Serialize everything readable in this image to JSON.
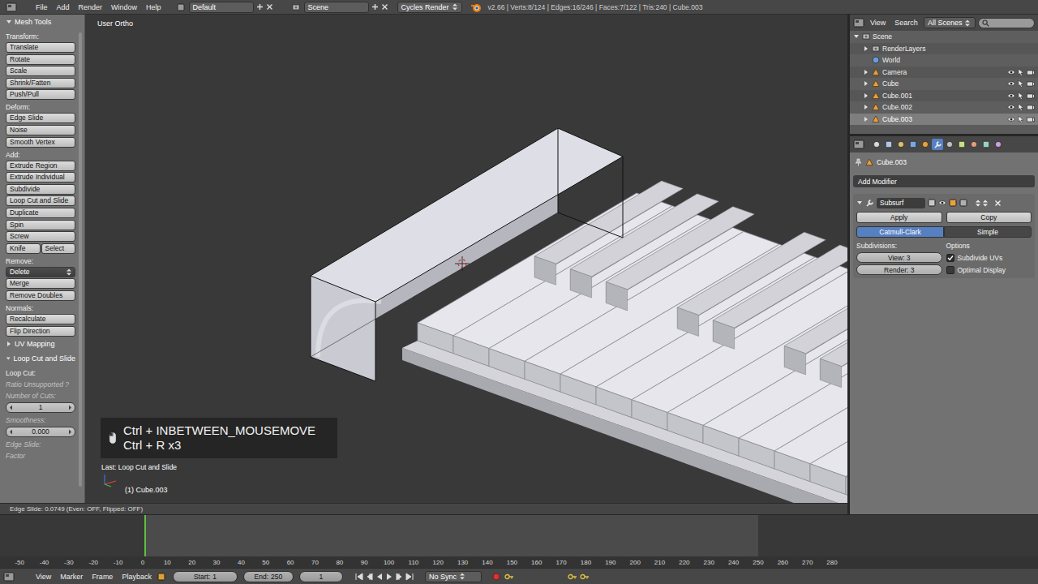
{
  "header": {
    "menus": [
      "File",
      "Add",
      "Render",
      "Window",
      "Help"
    ],
    "layout": "Default",
    "scene": "Scene",
    "engine": "Cycles Render",
    "stats": "v2.66 | Verts:8/124 | Edges:16/246 | Faces:7/122 | Tris:240 | Cube.003"
  },
  "toolShelf": {
    "title": "Mesh Tools",
    "expanded": true,
    "groups": [
      {
        "label": "Transform:",
        "rows": [
          {
            "kind": "button",
            "labels": [
              "Translate"
            ]
          },
          {
            "kind": "button",
            "labels": [
              "Rotate"
            ]
          },
          {
            "kind": "button",
            "labels": [
              "Scale"
            ]
          },
          {
            "kind": "button",
            "labels": [
              "Shrink/Fatten"
            ]
          },
          {
            "kind": "button",
            "labels": [
              "Push/Pull"
            ]
          }
        ]
      },
      {
        "label": "Deform:",
        "rows": [
          {
            "kind": "button",
            "labels": [
              "Edge Slide"
            ]
          },
          {
            "kind": "button",
            "labels": [
              "Noise"
            ]
          },
          {
            "kind": "button",
            "labels": [
              "Smooth Vertex"
            ]
          }
        ]
      },
      {
        "label": "Add:",
        "rows": [
          {
            "kind": "button",
            "labels": [
              "Extrude Region"
            ]
          },
          {
            "kind": "button",
            "labels": [
              "Extrude Individual"
            ]
          },
          {
            "kind": "button",
            "labels": [
              "Subdivide"
            ]
          },
          {
            "kind": "button",
            "labels": [
              "Loop Cut and Slide"
            ]
          },
          {
            "kind": "button",
            "labels": [
              "Duplicate"
            ]
          },
          {
            "kind": "button",
            "labels": [
              "Spin"
            ]
          },
          {
            "kind": "button",
            "labels": [
              "Screw"
            ]
          },
          {
            "kind": "pair",
            "labels": [
              "Knife",
              "Select"
            ]
          }
        ]
      },
      {
        "label": "Remove:",
        "rows": [
          {
            "kind": "menu",
            "labels": [
              "Delete"
            ]
          },
          {
            "kind": "button",
            "labels": [
              "Merge"
            ]
          },
          {
            "kind": "button",
            "labels": [
              "Remove Doubles"
            ]
          }
        ]
      },
      {
        "label": "Normals:",
        "rows": [
          {
            "kind": "button",
            "labels": [
              "Recalculate"
            ]
          },
          {
            "kind": "button",
            "labels": [
              "Flip Direction"
            ]
          }
        ]
      }
    ],
    "collapsed": [
      {
        "label": "UV Mapping",
        "expanded": false
      }
    ],
    "operator": {
      "title": "Loop Cut and Slide",
      "expanded": true,
      "items": [
        {
          "kind": "label",
          "text": "Loop Cut:"
        },
        {
          "kind": "note",
          "text": "Ratio Unsupported ?"
        },
        {
          "kind": "note",
          "text": "Number of Cuts:"
        },
        {
          "kind": "field",
          "text": "1"
        },
        {
          "kind": "note",
          "text": "Smoothness:"
        },
        {
          "kind": "field",
          "text": "0.000"
        },
        {
          "kind": "note",
          "text": "Edge Slide:"
        },
        {
          "kind": "note",
          "text": "Factor"
        }
      ]
    }
  },
  "viewport": {
    "view": "User Ortho",
    "keys": [
      "Ctrl + INBETWEEN_MOUSEMOVE",
      "Ctrl + R x3"
    ],
    "last": "Last: Loop Cut and Slide",
    "object": "(1) Cube.003",
    "status": "Edge Slide: 0.0749 (Even: OFF, Flipped: OFF)"
  },
  "outliner": {
    "menus": [
      "View",
      "Search"
    ],
    "filter": "All Scenes",
    "search": {
      "placeholder": ""
    },
    "rows": [
      {
        "label": "Scene",
        "depth": 0,
        "kind": "scene",
        "expanded": true,
        "selected": false
      },
      {
        "label": "RenderLayers",
        "depth": 1,
        "kind": "layers",
        "expanded": false,
        "selected": false
      },
      {
        "label": "World",
        "depth": 1,
        "kind": "world",
        "expanded": false,
        "selected": false
      },
      {
        "label": "Camera",
        "depth": 1,
        "kind": "object",
        "expanded": false,
        "selected": false
      },
      {
        "label": "Cube",
        "depth": 1,
        "kind": "object",
        "expanded": false,
        "selected": false
      },
      {
        "label": "Cube.001",
        "depth": 1,
        "kind": "object",
        "expanded": false,
        "selected": false
      },
      {
        "label": "Cube.002",
        "depth": 1,
        "kind": "object",
        "expanded": false,
        "selected": false
      },
      {
        "label": "Cube.003",
        "depth": 1,
        "kind": "object",
        "expanded": false,
        "selected": true
      }
    ]
  },
  "properties": {
    "contexts": [
      {
        "selected": false
      },
      {
        "selected": false
      },
      {
        "selected": false
      },
      {
        "selected": false
      },
      {
        "selected": false
      },
      {
        "selected": true
      },
      {
        "selected": false
      },
      {
        "selected": false
      },
      {
        "selected": false
      },
      {
        "selected": false
      },
      {
        "selected": false
      }
    ],
    "breadcrumb": "Cube.003",
    "addModifier": "Add Modifier",
    "modifier": {
      "name": "Subsurf",
      "expanded": true,
      "apply": "Apply",
      "copy": "Copy",
      "types": [
        {
          "label": "Catmull-Clark",
          "selected": true
        },
        {
          "label": "Simple",
          "selected": false
        }
      ],
      "subdivisionsLabel": "Subdivisions:",
      "subdivisions": [
        "View: 3",
        "Render: 3"
      ],
      "optionsLabel": "Options",
      "options": [
        {
          "label": "Subdivide UVs",
          "checked": true
        },
        {
          "label": "Optimal Display",
          "checked": false
        }
      ]
    }
  },
  "timeline": {
    "ticks": [
      "-50",
      "-40",
      "-30",
      "-20",
      "-10",
      "0",
      "10",
      "20",
      "30",
      "40",
      "50",
      "60",
      "70",
      "80",
      "90",
      "100",
      "110",
      "120",
      "130",
      "140",
      "150",
      "160",
      "170",
      "180",
      "190",
      "200",
      "210",
      "220",
      "230",
      "240",
      "250",
      "260",
      "270",
      "280"
    ],
    "current": "1",
    "menus": [
      "View",
      "Marker",
      "Frame",
      "Playback"
    ],
    "start": {
      "label": "Start:",
      "value": "1"
    },
    "end": {
      "label": "End:",
      "value": "250"
    },
    "frame": "1",
    "sync": "No Sync"
  }
}
